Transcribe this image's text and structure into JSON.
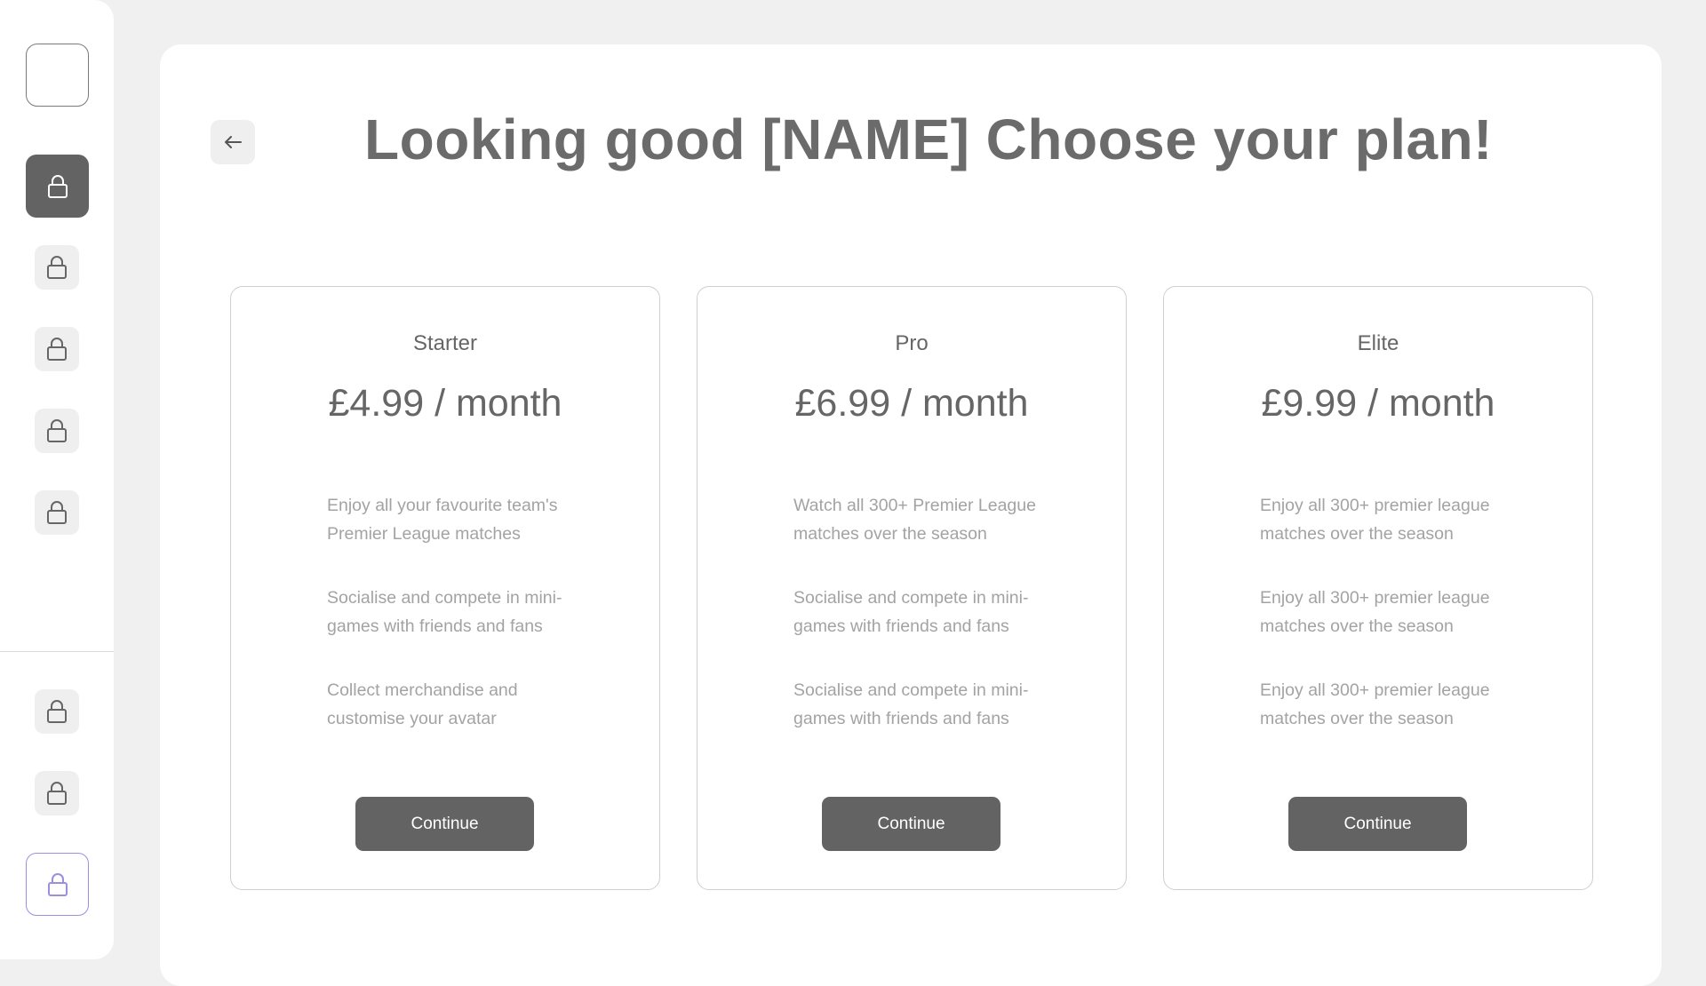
{
  "sidebar": {
    "logo_icon": "app-logo-placeholder",
    "items_icon": "lock-icon",
    "colors": {
      "active": "#636363",
      "inactive": "#efefef",
      "outline_accent": "#9a8fe0"
    }
  },
  "header": {
    "back_icon": "arrow-left-icon",
    "title": "Looking good [NAME] Choose your plan!"
  },
  "plans": [
    {
      "name": "Starter",
      "price": "£4.99 / month",
      "features": [
        "Enjoy all your favourite team's Premier League matches",
        "Socialise and compete in mini-games with friends and fans",
        "Collect merchandise and customise your avatar"
      ],
      "button_label": "Continue"
    },
    {
      "name": "Pro",
      "price": "£6.99 / month",
      "features": [
        "Watch all 300+ Premier League matches over the season",
        "Socialise and compete in mini-games with friends and fans",
        "Socialise and compete in mini-games with friends and fans"
      ],
      "button_label": "Continue"
    },
    {
      "name": "Elite",
      "price": "£9.99 / month",
      "features": [
        "Enjoy all 300+ premier league matches over the season",
        "Enjoy all 300+ premier league matches over the season",
        "Enjoy all 300+ premier league matches over the season"
      ],
      "button_label": "Continue"
    }
  ]
}
